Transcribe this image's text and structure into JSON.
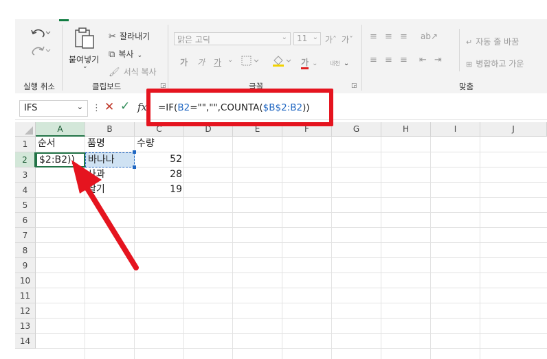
{
  "ribbon": {
    "undo_group": "실행 취소",
    "clipboard": {
      "paste": "붙여넣기",
      "cut": "잘라내기",
      "copy": "복사",
      "format_painter": "서식 복사",
      "group": "클립보드"
    },
    "font": {
      "name": "맑은 고딕",
      "size": "11",
      "group": "글꼴",
      "grow": "가ˆ",
      "shrink": "가ˇ",
      "bold": "가",
      "italic": "가",
      "underline": "가",
      "color_a": "가",
      "phonetic": "내천"
    },
    "alignment": {
      "wrap": "자동 줄 바꿈",
      "merge": "병합하고 가운",
      "group": "맞춤"
    }
  },
  "formula_bar": {
    "name_box": "IFS",
    "fx": "fx",
    "formula_prefix": "=IF(",
    "ref1": "B2",
    "formula_mid": "=\"\",\"\",COUNTA(",
    "ref2": "$B$2:B2",
    "formula_suffix": "))"
  },
  "grid": {
    "columns": [
      "A",
      "B",
      "C",
      "D",
      "E",
      "F",
      "G",
      "H",
      "I",
      "J"
    ],
    "rows": [
      "1",
      "2",
      "3",
      "4",
      "5",
      "6",
      "7",
      "8",
      "9",
      "10",
      "11",
      "12",
      "13",
      "14"
    ],
    "cells": {
      "A1": "순서",
      "B1": "품명",
      "C1": "수량",
      "A2": "$2:B2))",
      "B2": "바나나",
      "C2": "52",
      "B3": "사과",
      "C3": "28",
      "B4": "딸기",
      "C4": "19"
    }
  },
  "colors": {
    "accent": "#107c41",
    "annotation": "#e5141f",
    "reference": "#1f66c2"
  }
}
